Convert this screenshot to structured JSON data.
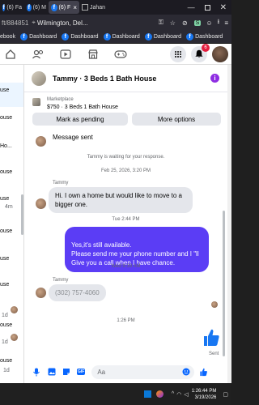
{
  "browser": {
    "tabs": [
      {
        "label": "(6) Fa"
      },
      {
        "label": "(6) M"
      },
      {
        "label": "(6) F"
      },
      {
        "label": "Jahan"
      }
    ],
    "url_prefix": "ft/884851",
    "url_location": "Wilmington, Del...",
    "bookmarks": [
      {
        "label": "ebook"
      },
      {
        "label": "Dashboard"
      },
      {
        "label": "Dashboard"
      },
      {
        "label": "Dashboard"
      },
      {
        "label": "Dashboard"
      },
      {
        "label": "Dashboard"
      }
    ]
  },
  "fb_nav": {
    "notifications_count": "6"
  },
  "left_strip": {
    "items": [
      {
        "label": "use"
      },
      {
        "label": "ouse"
      },
      {
        "label": "Ho..."
      },
      {
        "label": "ouse"
      },
      {
        "label": "use"
      },
      {
        "label": "4m"
      },
      {
        "label": "ouse"
      },
      {
        "label": "use"
      },
      {
        "label": "use"
      },
      {
        "label": "1d"
      },
      {
        "label": "ouse"
      },
      {
        "label": "1d"
      },
      {
        "label": "ouse"
      },
      {
        "label": "1d"
      }
    ]
  },
  "chat": {
    "title": "Tammy · 3 Beds 1 Bath House",
    "listing_source": "Marketplace",
    "listing_summary": "$750 · 3 Beds 1 Bath House",
    "mark_pending_label": "Mark as pending",
    "more_options_label": "More options",
    "messages": {
      "m1": "Message sent",
      "m2_status": "Tammy is waiting for your response.",
      "m3_time": "Feb 25, 2026, 3:20 PM",
      "m4_sender": "Tammy",
      "m4_text": "Hi.  I own a home but would like to move to a bigger one.",
      "m5_time": "Tue 2:44 PM",
      "m6_text": "Yes,it's still available.\nPlease send me your phone number and I \"ll Give you a call when I have chance.",
      "m7_time": "Wed 9:39 AM",
      "m8_sender": "Tammy",
      "m8_text": "(302) 757-4060",
      "m9_time": "1:26 PM",
      "sent_label": "Sent"
    },
    "composer_placeholder": "Aa"
  },
  "taskbar": {
    "time": "1:26:44 PM",
    "date": "3/19/2026"
  },
  "colors": {
    "accent": "#5b3df5",
    "fb_blue": "#1877f2",
    "notification_red": "#e41e3f"
  }
}
